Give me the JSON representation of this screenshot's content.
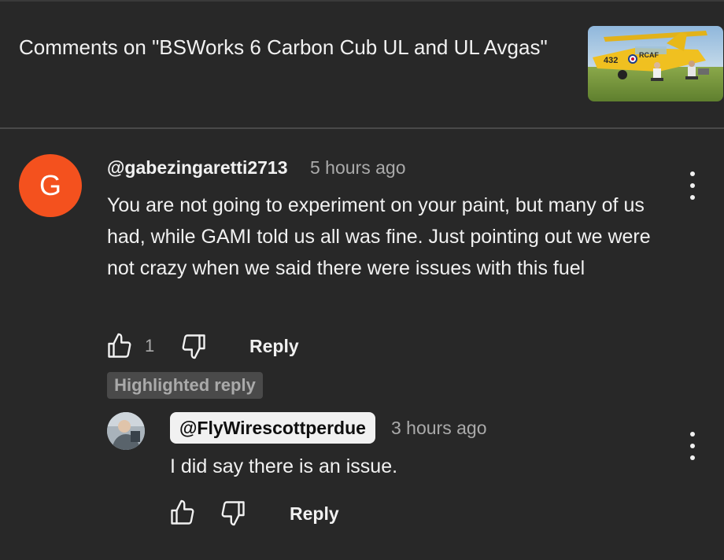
{
  "header": {
    "title": "Comments on \"BSWorks 6 Carbon Cub UL and UL Avgas\"",
    "thumbnail_text": "432 RCAF"
  },
  "comment": {
    "avatar_letter": "G",
    "author": "@gabezingaretti2713",
    "time": "5 hours ago",
    "text": "You are not going to experiment on your paint, but many of us had, while GAMI told us all was fine. Just pointing out we were not crazy when we said there were issues with this fuel",
    "like_count": "1",
    "reply_label": "Reply",
    "menu_icon": "more-vert-icon"
  },
  "highlight_label": "Highlighted reply",
  "reply": {
    "author": "@FlyWirescottperdue",
    "time": "3 hours ago",
    "text": "I did say there is an issue.",
    "reply_label": "Reply",
    "menu_icon": "more-vert-icon"
  },
  "colors": {
    "background": "#282828",
    "avatar": "#f4511e",
    "secondary_text": "#aaaaaa",
    "primary_text": "#f1f1f1",
    "badge": "#4a4a4a"
  }
}
